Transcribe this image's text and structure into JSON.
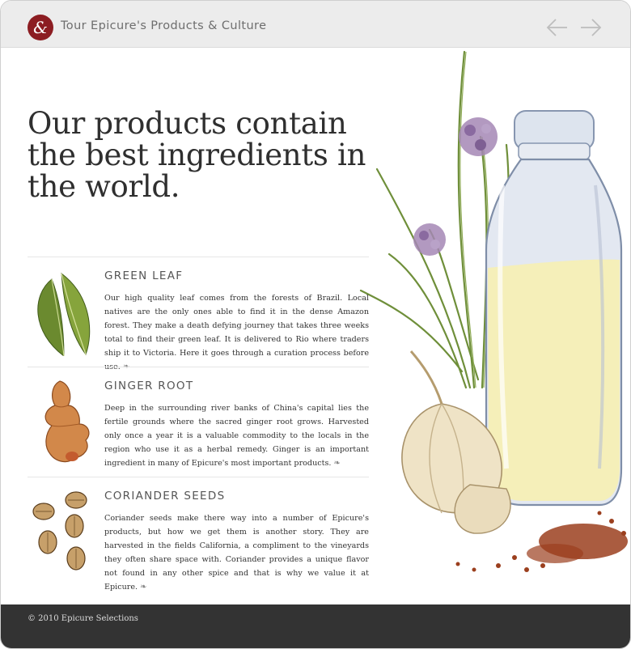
{
  "header": {
    "logo_letter": "&",
    "title": "Tour Epicure's Products & Culture",
    "prev_icon": "arrow-left-icon",
    "next_icon": "arrow-right-icon"
  },
  "headline": "Our products contain the best ingredients in the world.",
  "products": [
    {
      "name": "Green Leaf",
      "description": "Our high quality leaf comes from the forests of Brazil. Local natives are the only ones able to find it in the dense Amazon forest. They make a death defying journey that takes three weeks total to find their green leaf. It is delivered to Rio where traders ship it to Victoria. Here it goes through a curation process before use.",
      "icon": "green-leaf-illustration"
    },
    {
      "name": "Ginger Root",
      "description": "Deep in the surrounding river banks of China's capital lies the fertile grounds where the sacred ginger root grows. Harvested only once a year it is a valuable commodity to the locals in the region who use it as a herbal remedy. Ginger is an important ingredient in many of Epicure's most important products.",
      "icon": "ginger-root-illustration"
    },
    {
      "name": "Coriander Seeds",
      "description": "Coriander seeds make there way into a number of Epicure's products, but how we get them is another story. They are harvested in the fields California, a compliment to the vineyards they often share space with. Coriander provides a unique flavor not found in any other spice and that is why we value it at Epicure.",
      "icon": "coriander-seeds-illustration"
    }
  ],
  "fleuron": "❧",
  "footer": {
    "copyright": "© 2010 Epicure Selections"
  },
  "colors": {
    "brand": "#8c1d22",
    "header_bg": "#ececec",
    "footer_bg": "#333333"
  }
}
